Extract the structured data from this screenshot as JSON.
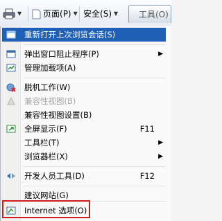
{
  "toolbar": {
    "page_label": "页面",
    "page_key": "(P)",
    "safety_label": "安全",
    "safety_key": "(S)",
    "tools_label": "工具",
    "tools_key": "(O)"
  },
  "menu": {
    "reopen": "重新打开上次浏览会话(S)",
    "popup": "弹出窗口阻止程序(P)",
    "addons": "管理加载项(A)",
    "offline": "脱机工作(W)",
    "compat": "兼容性视图(B)",
    "compat_settings": "兼容性视图设置(B)",
    "fullscreen": "全屏显示(F)",
    "fullscreen_sc": "F11",
    "toolbars": "工具栏(T)",
    "explorer_bars": "浏览器栏(X)",
    "devtools": "开发人员工具(D)",
    "devtools_sc": "F12",
    "suggested": "建议网站(G)",
    "internet_options": "Internet 选项(O)"
  },
  "colors": {
    "highlight": "#1f5fb5",
    "red_box": "#d21a1a"
  }
}
